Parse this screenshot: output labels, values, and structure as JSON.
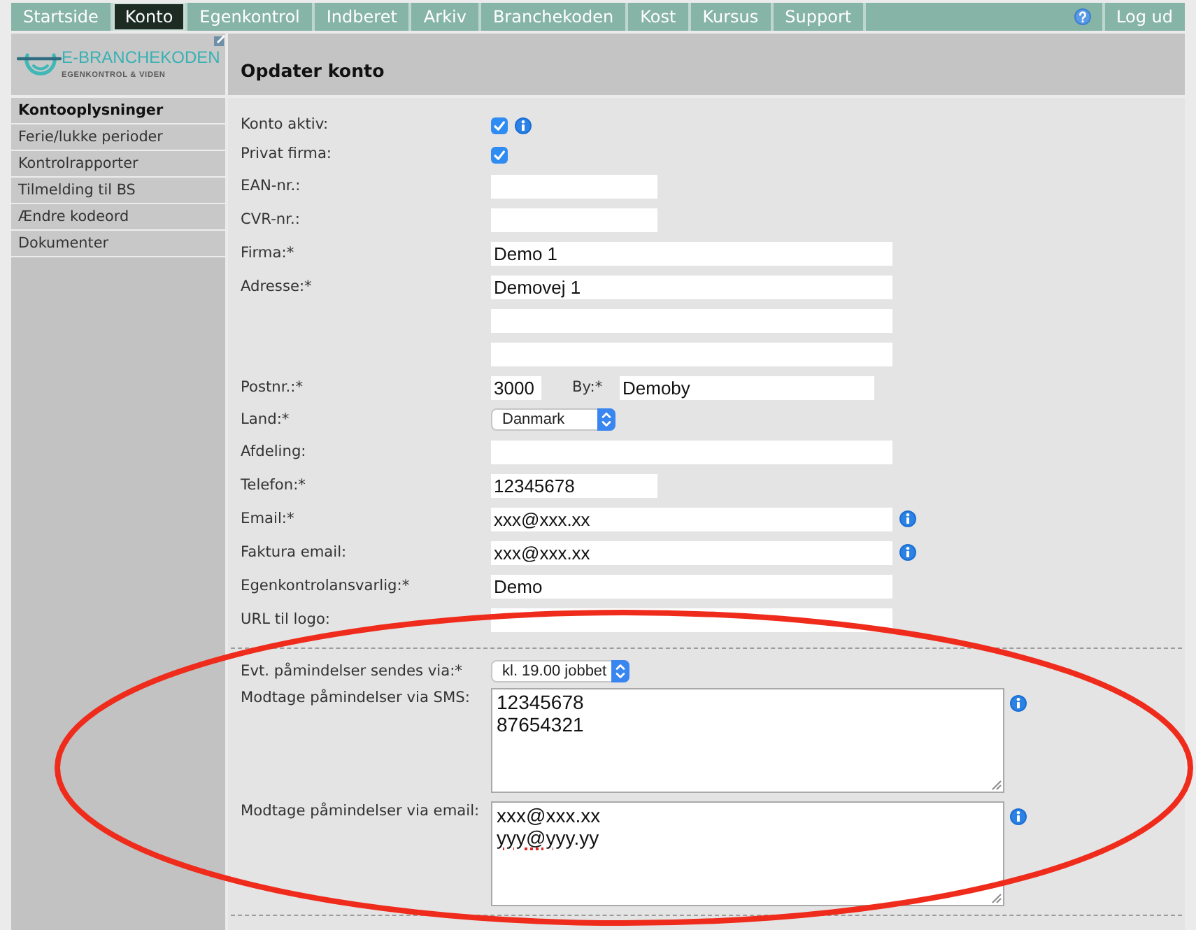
{
  "nav": {
    "tabs": [
      {
        "label": "Startside",
        "selected": false
      },
      {
        "label": "Konto",
        "selected": true
      },
      {
        "label": "Egenkontrol",
        "selected": false
      },
      {
        "label": "Indberet",
        "selected": false
      },
      {
        "label": "Arkiv",
        "selected": false
      },
      {
        "label": "Branchekoden",
        "selected": false
      },
      {
        "label": "Kost",
        "selected": false
      },
      {
        "label": "Kursus",
        "selected": false
      },
      {
        "label": "Support",
        "selected": false
      }
    ],
    "logout": "Log ud"
  },
  "logo": {
    "name": "E-BRANCHEKODEN",
    "tagline": "EGENKONTROL & VIDEN"
  },
  "page_title": "Opdater konto",
  "sidebar": {
    "items": [
      {
        "label": "Kontooplysninger",
        "selected": true
      },
      {
        "label": "Ferie/lukke perioder",
        "selected": false
      },
      {
        "label": "Kontrolrapporter",
        "selected": false
      },
      {
        "label": "Tilmelding til BS",
        "selected": false
      },
      {
        "label": "Ændre kodeord",
        "selected": false
      },
      {
        "label": "Dokumenter",
        "selected": false
      }
    ]
  },
  "form": {
    "sections": [
      {
        "rows": [
          {
            "kind": "checkbox",
            "label": "Konto aktiv:",
            "checked": true,
            "info": true
          },
          {
            "kind": "checkbox",
            "label": "Privat firma:",
            "checked": true
          },
          {
            "kind": "number",
            "label": "EAN-nr.:"
          },
          {
            "kind": "number",
            "label": "CVR-nr.:"
          },
          {
            "kind": "text",
            "label": "Firma:*",
            "value": "Demo 1"
          },
          {
            "kind": "text",
            "label": "Adresse:*",
            "value": "Demovej 1"
          },
          {
            "kind": "text"
          },
          {
            "kind": "text"
          },
          {
            "kind": "postcode",
            "label": "Postnr.:*",
            "value": "3000",
            "city_label": "By:*",
            "city_value": "Demoby"
          },
          {
            "kind": "select",
            "label": "Land:*",
            "value": "Danmark"
          },
          {
            "kind": "text",
            "label": "Afdeling:"
          },
          {
            "kind": "number",
            "label": "Telefon:*",
            "value": "12345678"
          },
          {
            "kind": "text",
            "label": "Email:*",
            "value": "xxx@xxx.xx",
            "info": true
          },
          {
            "kind": "text",
            "label": "Faktura email:",
            "value": "xxx@xxx.xx",
            "info": true
          },
          {
            "kind": "text",
            "label": "Egenkontrolansvarlig:*",
            "value": "Demo"
          },
          {
            "kind": "text",
            "label": "URL til logo:"
          }
        ]
      },
      {
        "rows": [
          {
            "kind": "select",
            "label": "Evt. påmindelser sendes via:*",
            "value": "kl. 19.00 jobbet"
          },
          {
            "kind": "textarea",
            "label": "Modtage påmindelser via SMS:",
            "lines": [
              [
                {
                  "text": "12345678",
                  "misspelled": false
                }
              ],
              [
                {
                  "text": "87654321",
                  "misspelled": false
                }
              ]
            ],
            "info": true
          },
          {
            "kind": "textarea",
            "label": "Modtage påmindelser via email:",
            "lines": [
              [
                {
                  "text": "xxx@xxx.xx",
                  "misspelled": false
                }
              ],
              [
                {
                  "text": "yyy@yyy",
                  "misspelled": true
                },
                {
                  "text": ".yy",
                  "misspelled": false
                }
              ]
            ],
            "info": true
          }
        ]
      }
    ]
  }
}
